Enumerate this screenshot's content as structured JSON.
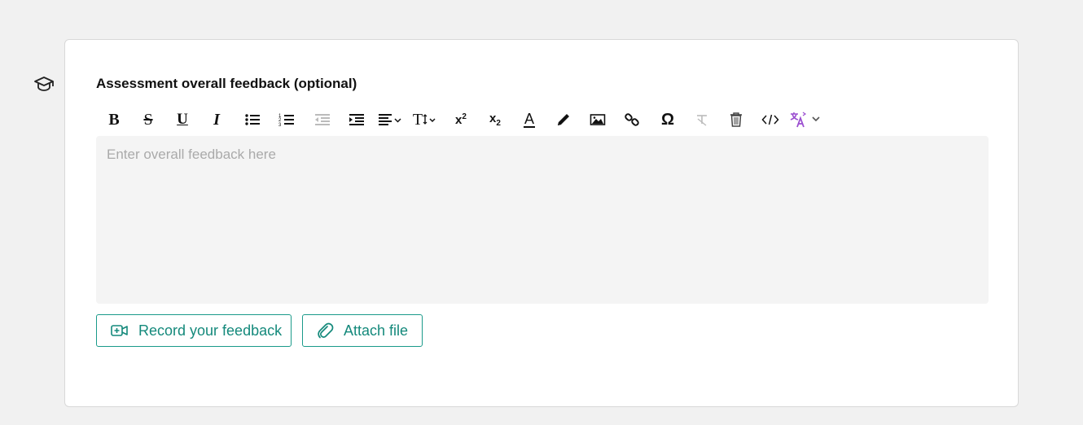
{
  "section": {
    "title": "Assessment overall feedback (optional)"
  },
  "editor": {
    "placeholder": "Enter overall feedback here"
  },
  "toolbar": {
    "items": [
      "bold-icon",
      "strikethrough-icon",
      "underline-icon",
      "italic-icon",
      "bullet-list-icon",
      "numbered-list-icon",
      "outdent-icon",
      "indent-icon",
      "align-icon",
      "font-size-icon",
      "superscript-icon",
      "subscript-icon",
      "font-color-icon",
      "pencil-icon",
      "image-icon",
      "link-icon",
      "omega-icon",
      "clear-format-icon",
      "trash-icon",
      "code-icon",
      "translate-icon"
    ],
    "bold": "B",
    "strike": "S",
    "underline": "U",
    "italic": "I",
    "font_size": "T",
    "superscript_base": "x",
    "superscript_exp": "2",
    "subscript_base": "x",
    "subscript_sub": "2",
    "font_color": "A",
    "omega": "Ω"
  },
  "actions": {
    "record_label": "Record your feedback",
    "attach_label": "Attach file"
  },
  "colors": {
    "accent": "#14897b",
    "translate": "#9b4fd0",
    "disabled": "#bbbbbb"
  }
}
